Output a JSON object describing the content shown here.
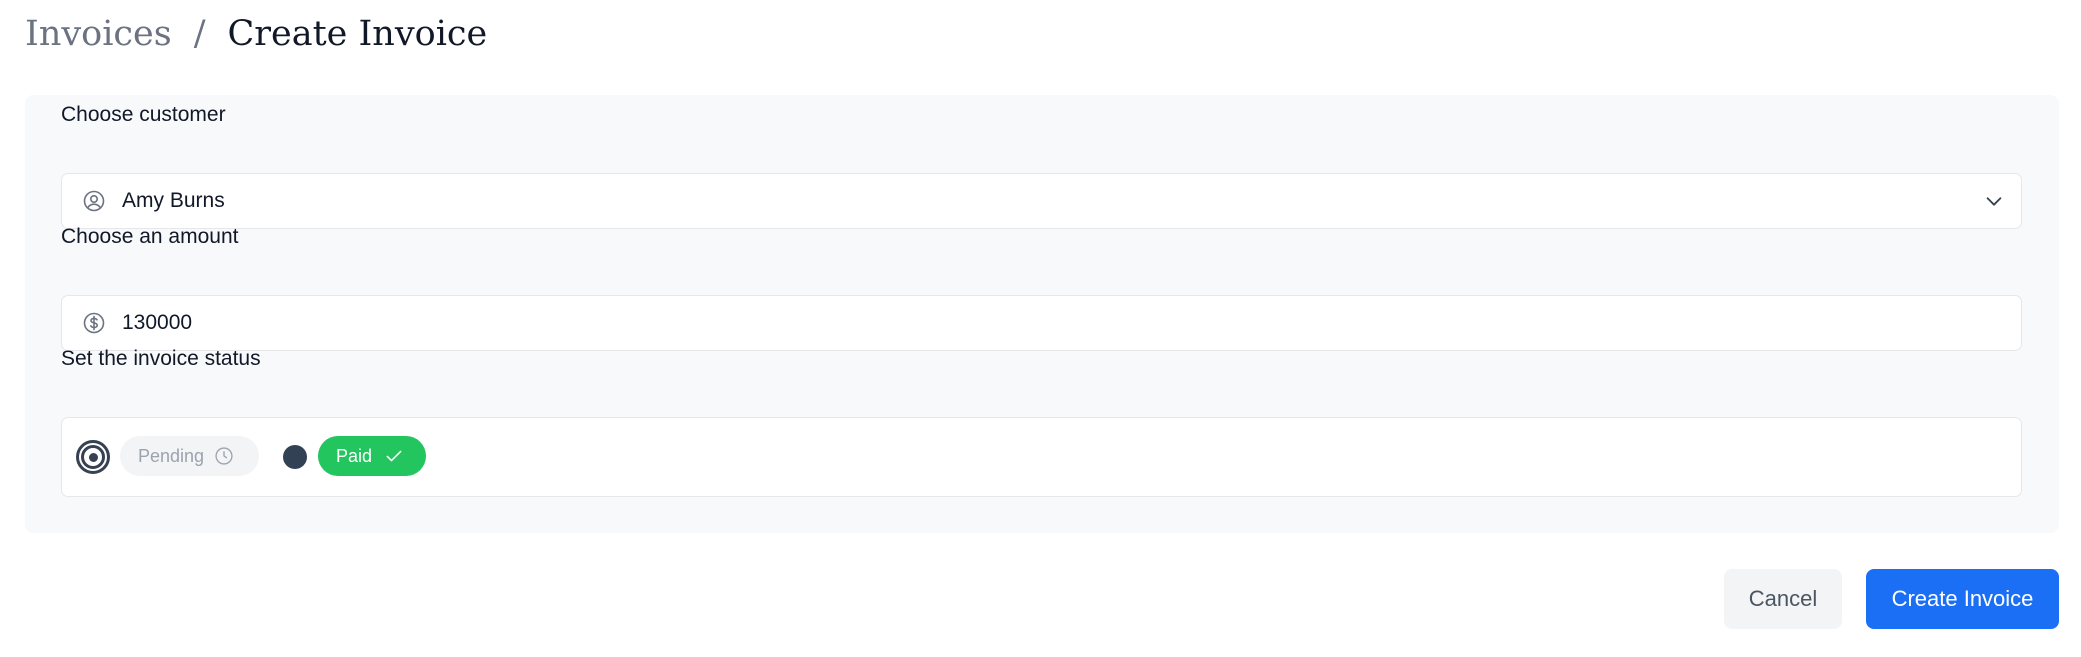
{
  "breadcrumb": {
    "parent": "Invoices",
    "separator": "/",
    "current": "Create Invoice"
  },
  "form": {
    "customer": {
      "label": "Choose customer",
      "value": "Amy Burns",
      "icon": "user-circle-icon"
    },
    "amount": {
      "label": "Choose an amount",
      "value": "130000",
      "icon": "dollar-circle-icon"
    },
    "status": {
      "label": "Set the invoice status",
      "selected": "pending",
      "options": [
        {
          "id": "pending",
          "label": "Pending",
          "icon": "clock-icon",
          "color": "#f3f4f6"
        },
        {
          "id": "paid",
          "label": "Paid",
          "icon": "check-icon",
          "color": "#22c55e"
        }
      ]
    }
  },
  "actions": {
    "cancel_label": "Cancel",
    "submit_label": "Create Invoice"
  },
  "colors": {
    "primary": "#1a6ff5",
    "paid": "#22c55e",
    "card_background": "#f8f9fb"
  }
}
